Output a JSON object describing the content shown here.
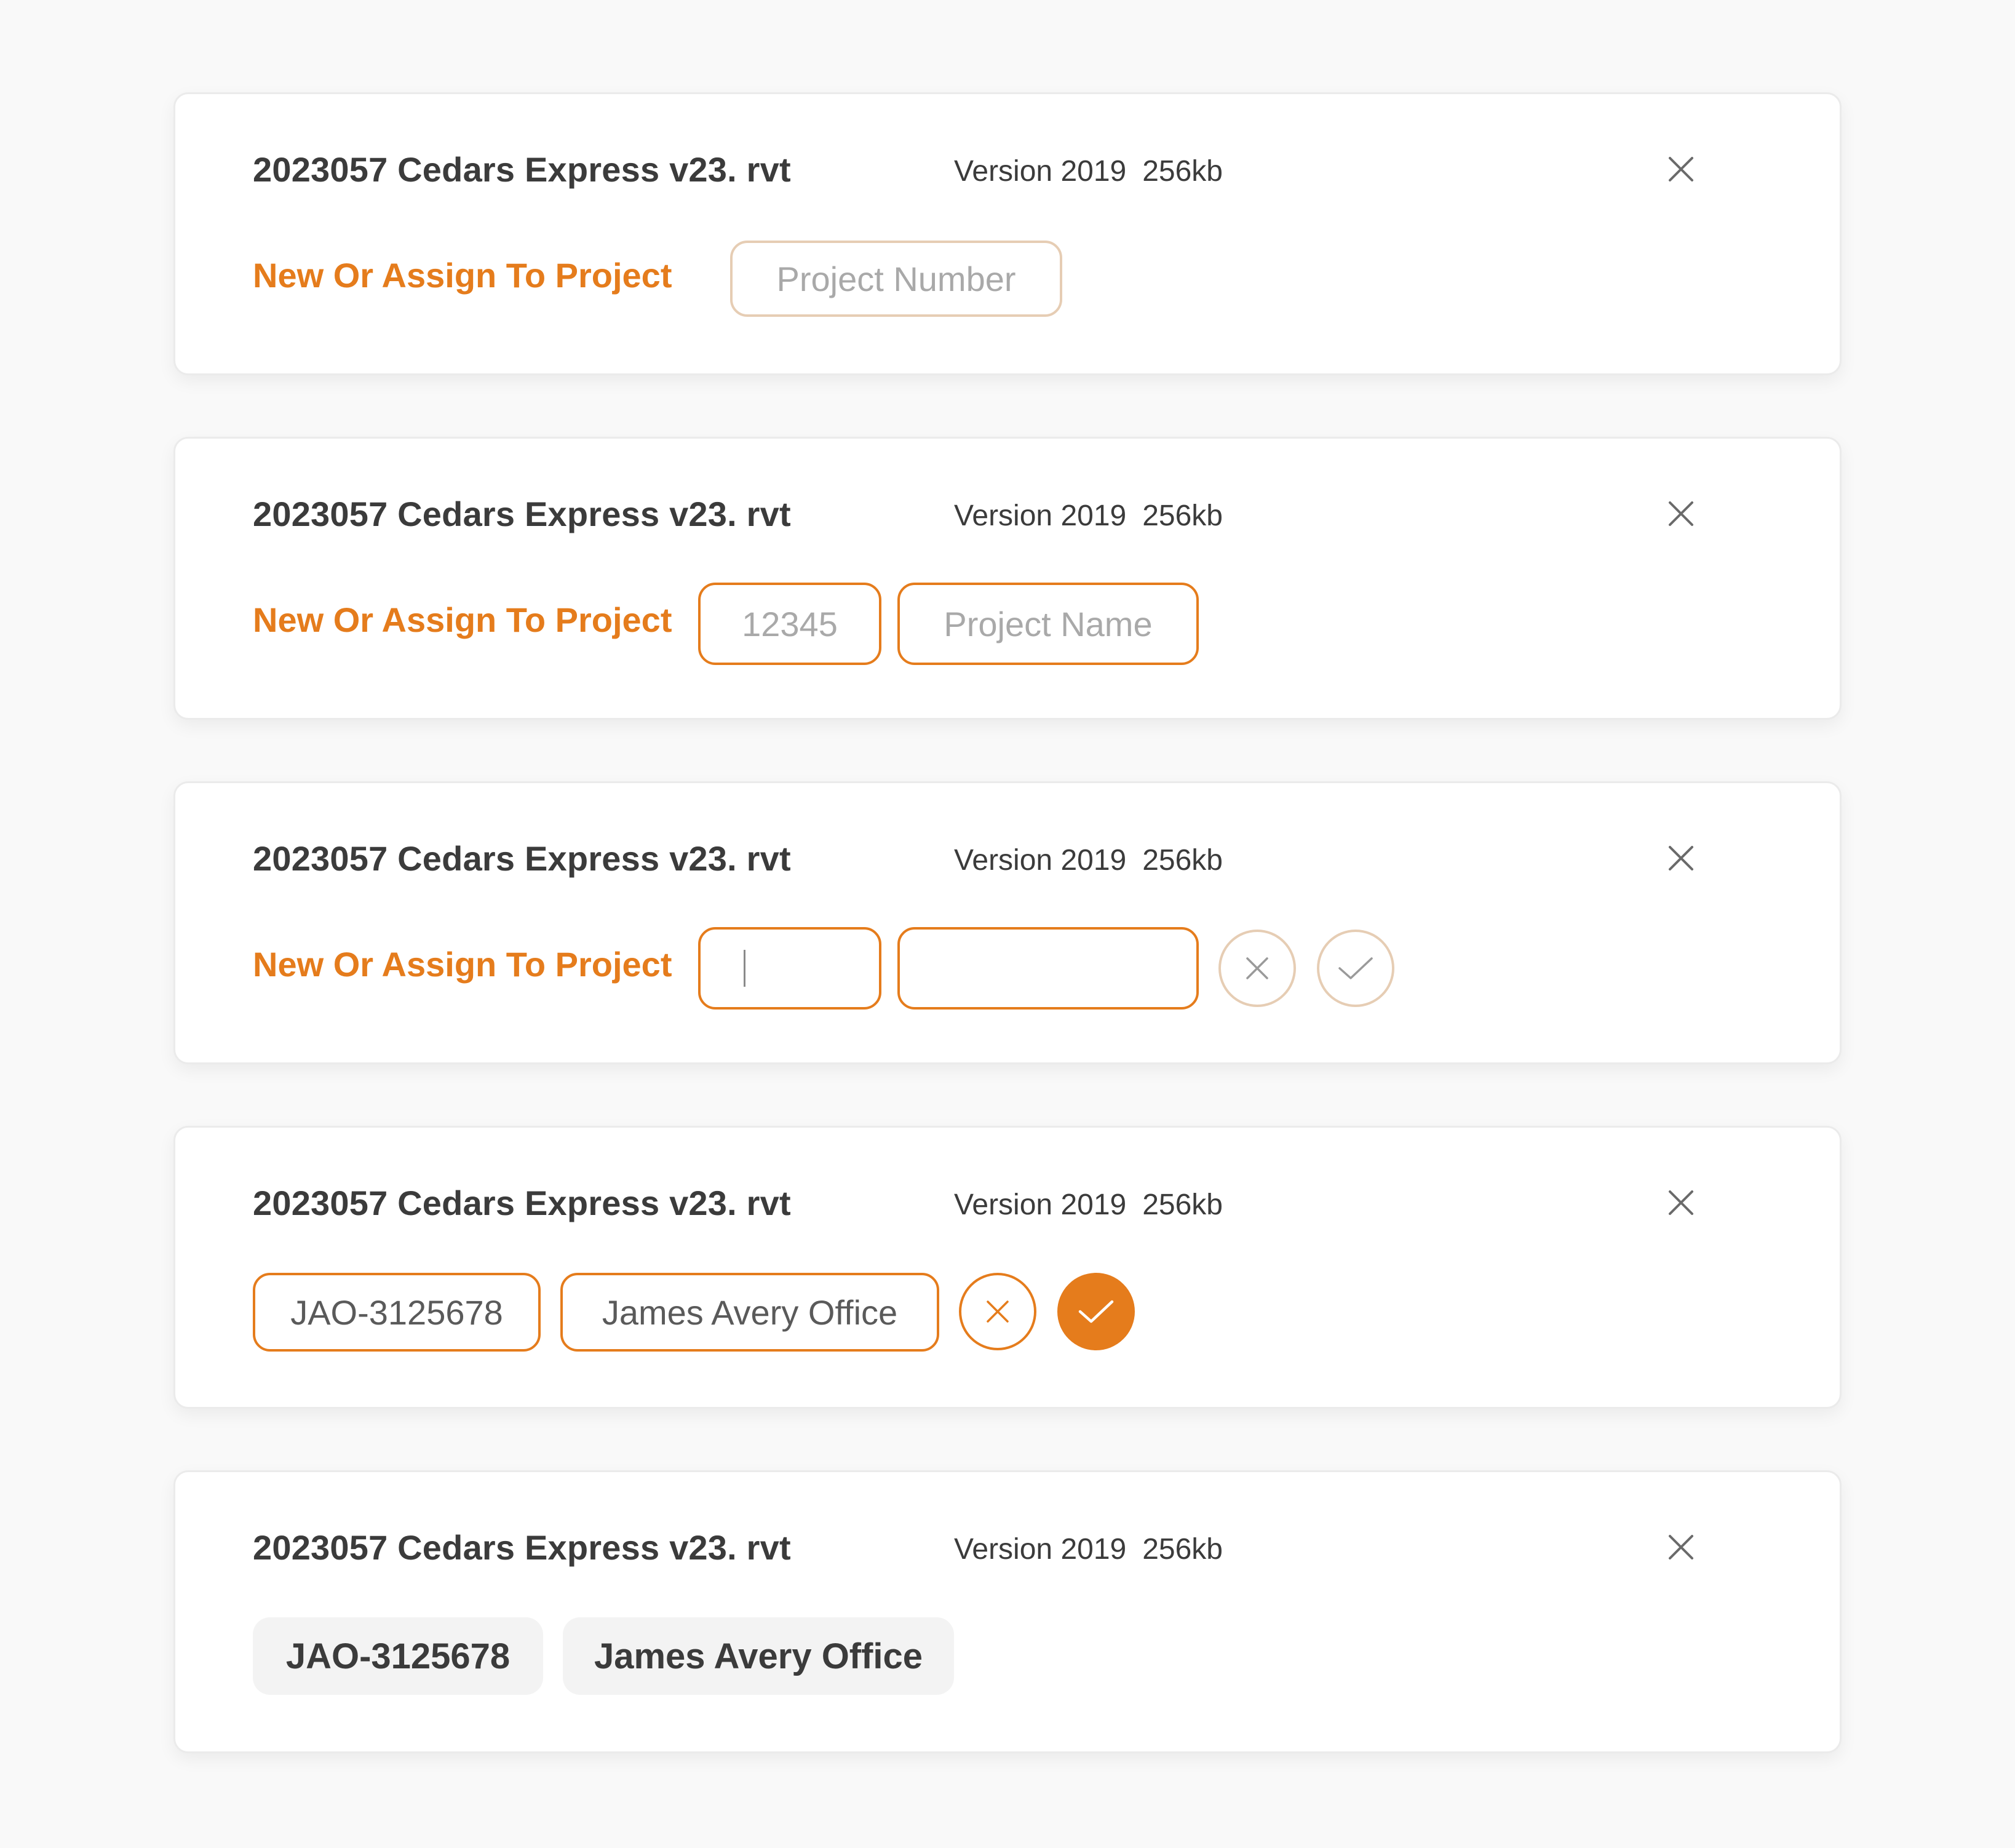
{
  "colors": {
    "accent": "#e57c1c",
    "muted_border": "#e6cdb4",
    "chip_bg": "#f3f3f3",
    "page_bg": "#f9f9f9"
  },
  "cards": [
    {
      "file_name": "2023057 Cedars Express v23. rvt",
      "version": "Version 2019",
      "size": "256kb",
      "assign_label": "New Or Assign To  Project",
      "project_number_placeholder": "Project Number"
    },
    {
      "file_name": "2023057 Cedars Express v23. rvt",
      "version": "Version 2019",
      "size": "256kb",
      "assign_label": "New Or Assign To  Project",
      "project_number_placeholder": "12345",
      "project_name_placeholder": "Project Name"
    },
    {
      "file_name": "2023057 Cedars Express v23. rvt",
      "version": "Version 2019",
      "size": "256kb",
      "assign_label": "New Or Assign To  Project",
      "project_number_value": "",
      "project_name_value": ""
    },
    {
      "file_name": "2023057 Cedars Express v23. rvt",
      "version": "Version 2019",
      "size": "256kb",
      "project_number_value": "JAO-3125678",
      "project_name_value": "James Avery Office"
    },
    {
      "file_name": "2023057 Cedars Express v23. rvt",
      "version": "Version 2019",
      "size": "256kb",
      "project_number_value": "JAO-3125678",
      "project_name_value": "James Avery Office"
    }
  ],
  "icons": {
    "close": "close-icon",
    "confirm": "check-icon",
    "cancel": "close-icon"
  }
}
